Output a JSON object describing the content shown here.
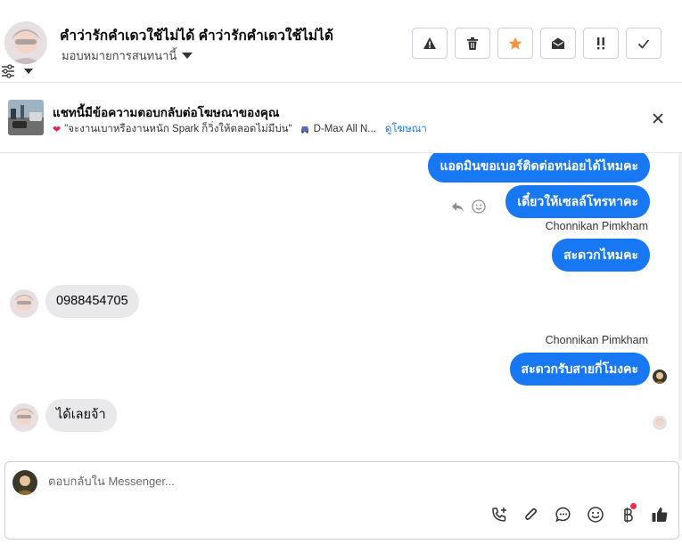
{
  "header": {
    "title": "คำว่ารักคำเดวใช้ไม่ได้ คำว่ารักคำเดวใช้ไม่ได้",
    "assign_label": "มอบหมายการสนทนานี้",
    "actions": [
      "spam-icon",
      "trash-icon",
      "star-icon",
      "mark-unread-icon",
      "follow-up-icon",
      "done-icon"
    ],
    "star_color": "#f7923a"
  },
  "ad": {
    "title": "แชทนี้มีข้อความตอบกลับต่อโฆษณาของคุณ",
    "subtitle": "\"จะงานเบาหรืองานหนัก Spark ก็วิ่งให้ตลอดไม่มีบ่น\"",
    "product": "D-Max All N...",
    "link": "ดูโฆษณา"
  },
  "messages": {
    "out1": "แอดมินขอเบอร์ติดต่อหน่อยได้ไหมคะ",
    "out2": "เดี๋ยวให้เซลล์โทรหาคะ",
    "sender1": "Chonnikan Pimkham",
    "out3": "สะดวกไหมคะ",
    "in1": "0988454705",
    "sender2": "Chonnikan Pimkham",
    "out4": "สะดวกรับสายกี่โมงคะ",
    "in2": "ได้เลยจ้า"
  },
  "composer": {
    "placeholder": "ตอบกลับใน Messenger..."
  },
  "colors": {
    "accent": "#1877f2",
    "incoming_bubble": "#e9e9eb",
    "notification_dot": "#f02849"
  }
}
